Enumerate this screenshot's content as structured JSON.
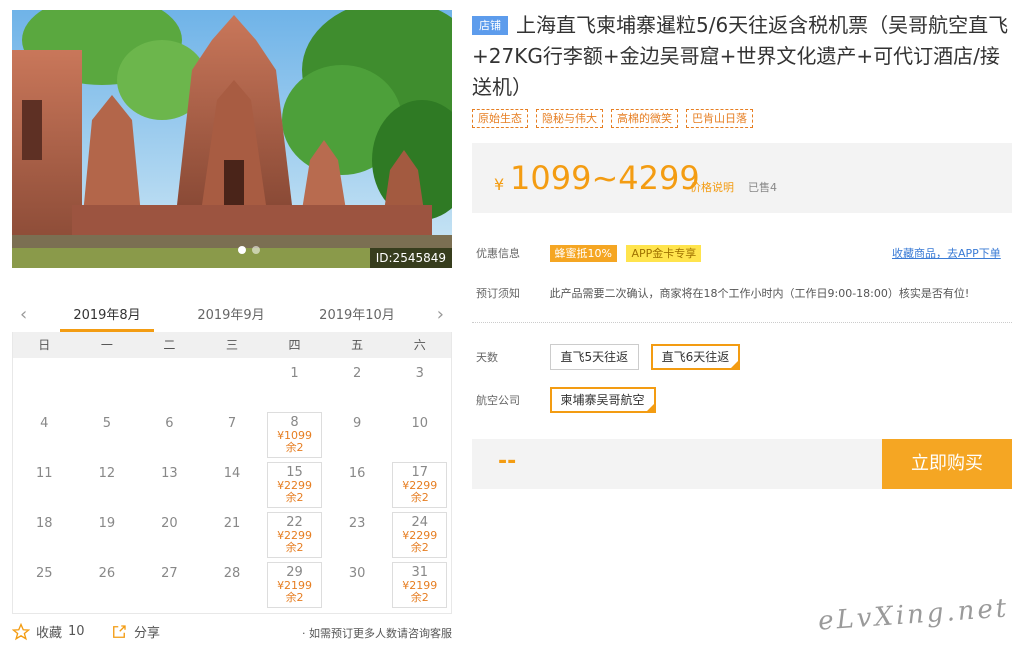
{
  "photo": {
    "id_label": "ID:2545849",
    "slides": 2
  },
  "calendar": {
    "months": [
      "2019年8月",
      "2019年9月",
      "2019年10月"
    ],
    "active_month": 0,
    "prev_arrow": "‹",
    "next_arrow": "›",
    "weekdays": [
      "日",
      "一",
      "二",
      "三",
      "四",
      "五",
      "六"
    ],
    "days": [
      {
        "d": ""
      },
      {
        "d": ""
      },
      {
        "d": ""
      },
      {
        "d": ""
      },
      {
        "d": "1"
      },
      {
        "d": "2"
      },
      {
        "d": "3"
      },
      {
        "d": "4"
      },
      {
        "d": "5"
      },
      {
        "d": "6"
      },
      {
        "d": "7"
      },
      {
        "d": "8",
        "p": "¥1099",
        "r": "余2"
      },
      {
        "d": "9"
      },
      {
        "d": "10"
      },
      {
        "d": "11"
      },
      {
        "d": "12"
      },
      {
        "d": "13"
      },
      {
        "d": "14"
      },
      {
        "d": "15",
        "p": "¥2299",
        "r": "余2"
      },
      {
        "d": "16"
      },
      {
        "d": "17",
        "p": "¥2299",
        "r": "余2"
      },
      {
        "d": "18"
      },
      {
        "d": "19"
      },
      {
        "d": "20"
      },
      {
        "d": "21"
      },
      {
        "d": "22",
        "p": "¥2299",
        "r": "余2"
      },
      {
        "d": "23"
      },
      {
        "d": "24",
        "p": "¥2299",
        "r": "余2"
      },
      {
        "d": "25"
      },
      {
        "d": "26"
      },
      {
        "d": "27"
      },
      {
        "d": "28"
      },
      {
        "d": "29",
        "p": "¥2199",
        "r": "余2"
      },
      {
        "d": "30"
      },
      {
        "d": "31",
        "p": "¥2199",
        "r": "余2"
      }
    ]
  },
  "bottom": {
    "fav_label": "收藏",
    "fav_count": "10",
    "share_label": "分享",
    "note": "· 如需预订更多人数请咨询客服"
  },
  "product": {
    "shop_badge": "店铺",
    "title": "上海直飞柬埔寨暹粒5/6天往返含税机票（吴哥航空直飞+27KG行李额+金边吴哥窟+世界文化遗产+可代订酒店/接送机）",
    "tags": [
      "原始生态",
      "隐秘与伟大",
      "高棉的微笑",
      "巴肯山日落"
    ]
  },
  "price": {
    "currency": "¥",
    "range": "1099~4299",
    "explain": "价格说明",
    "sold": "已售4"
  },
  "info": {
    "promo_label": "优惠信息",
    "promo_badges": [
      "蜂蜜抵10%",
      "APP金卡专享"
    ],
    "fav_link": "收藏商品，去APP下单",
    "notice_label": "预订须知",
    "notice_text": "此产品需要二次确认，商家将在18个工作小时内（工作日9:00-18:00）核实是否有位!"
  },
  "options": {
    "days_label": "天数",
    "days_options": [
      "直飞5天往返",
      "直飞6天往返"
    ],
    "days_selected": 1,
    "airline_label": "航空公司",
    "airline_options": [
      "柬埔寨吴哥航空"
    ],
    "airline_selected": 0
  },
  "buy": {
    "placeholder_price": "--",
    "button": "立即购买"
  },
  "watermark": "eLvXing.net",
  "colors": {
    "accent": "#f39c12",
    "button": "#f5a623",
    "link": "#3a7bd5",
    "badge_blue": "#5d9cec"
  }
}
